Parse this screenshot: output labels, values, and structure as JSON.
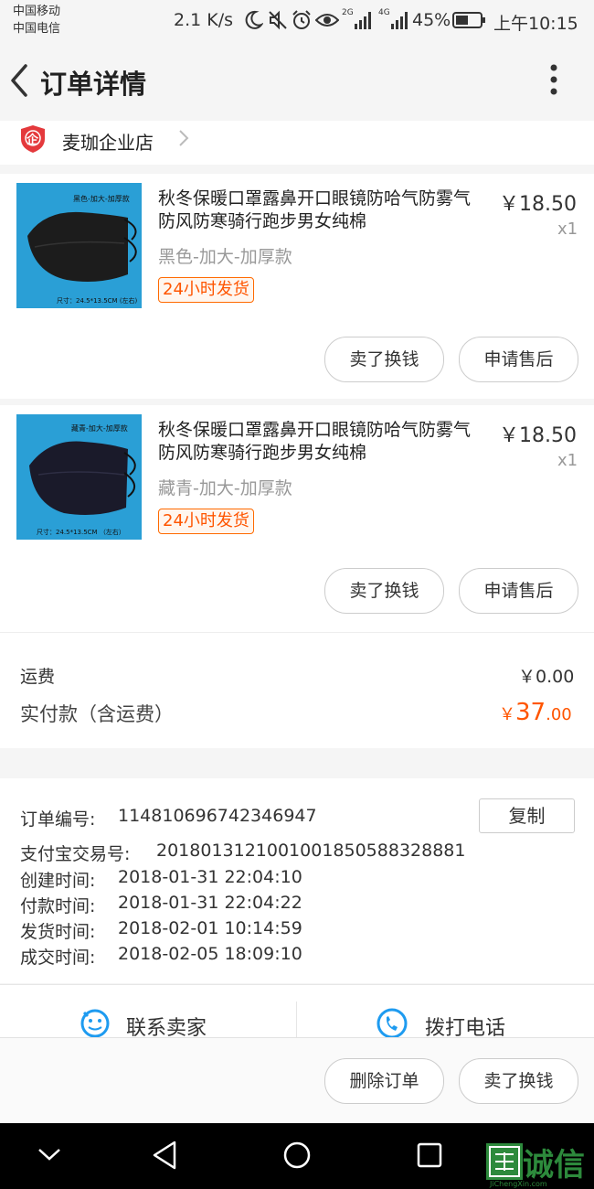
{
  "status": {
    "carrier1": "中国移动",
    "carrier2": "中国电信",
    "speed": "2.1 K/s",
    "net1": "2G",
    "net2": "4G",
    "battery": "45%",
    "time": "上午10:15"
  },
  "header": {
    "back": "‹",
    "title": "订单详情",
    "menu": "⋮"
  },
  "shop": {
    "badge": "企",
    "name": "麦珈企业店"
  },
  "items": [
    {
      "thumb_caption": "黑色-加大-加厚款",
      "thumb_size": "尺寸：24.5*13.5CM (左右)",
      "title": "秋冬保暖口罩露鼻开口眼镜防哈气防雾气防风防寒骑行跑步男女纯棉",
      "spec": "黑色-加大-加厚款",
      "tag": "24小时发货",
      "price": "￥18.50",
      "qty": "x1",
      "btn1": "卖了换钱",
      "btn2": "申请售后"
    },
    {
      "thumb_caption": "藏青-加大-加厚款",
      "thumb_size": "尺寸：24.5*13.5CM （左右）",
      "title": "秋冬保暖口罩露鼻开口眼镜防哈气防雾气防风防寒骑行跑步男女纯棉",
      "spec": "藏青-加大-加厚款",
      "tag": "24小时发货",
      "price": "￥18.50",
      "qty": "x1",
      "btn1": "卖了换钱",
      "btn2": "申请售后"
    }
  ],
  "summary": {
    "shipping_label": "运费",
    "shipping_value": "￥0.00",
    "paid_label": "实付款（含运费）",
    "paid_currency": "￥",
    "paid_int": "37",
    "paid_dec": ".00"
  },
  "order": {
    "id_label": "订单编号:",
    "id_value": "114810696742346947",
    "copy": "复制",
    "alipay_label": "支付宝交易号:",
    "alipay_value": "2018013121001001850588328881",
    "created_label": "创建时间:",
    "created_value": "2018-01-31 22:04:10",
    "paid_label": "付款时间:",
    "paid_value": "2018-01-31 22:04:22",
    "shipped_label": "发货时间:",
    "shipped_value": "2018-02-01 10:14:59",
    "done_label": "成交时间:",
    "done_value": "2018-02-05 18:09:10"
  },
  "contact": {
    "seller": "联系卖家",
    "phone": "拨打电话"
  },
  "bottom": {
    "delete": "删除订单",
    "sell": "卖了换钱"
  },
  "watermark": {
    "text": "诚信",
    "sub": "JiChengXin.com"
  },
  "colors": {
    "accent": "#ff5500",
    "icon_blue": "#1e9bf0",
    "shop_badge": "#e4393c"
  }
}
